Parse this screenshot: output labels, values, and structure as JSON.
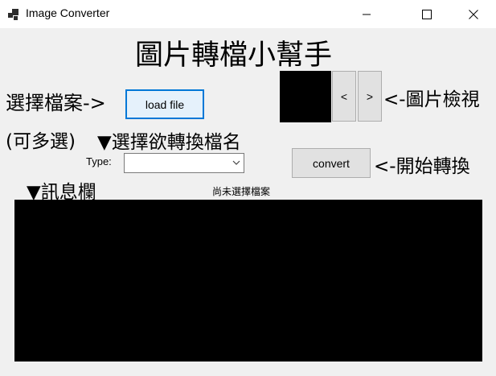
{
  "window": {
    "title": "Image Converter"
  },
  "header": {
    "title": "圖片轉檔小幫手"
  },
  "file_section": {
    "label": "選擇檔案->",
    "load_button": "load file",
    "multi_note": "(可多選)"
  },
  "preview_section": {
    "prev_button": "<",
    "next_button": ">",
    "label": "<-圖片檢視"
  },
  "convert_section": {
    "heading": "▼選擇欲轉換檔名",
    "type_label": "Type:",
    "type_value": "",
    "convert_button": "convert",
    "start_label": "<-開始轉換"
  },
  "message_section": {
    "heading": "▼訊息欄",
    "status": "尚未選擇檔案"
  }
}
